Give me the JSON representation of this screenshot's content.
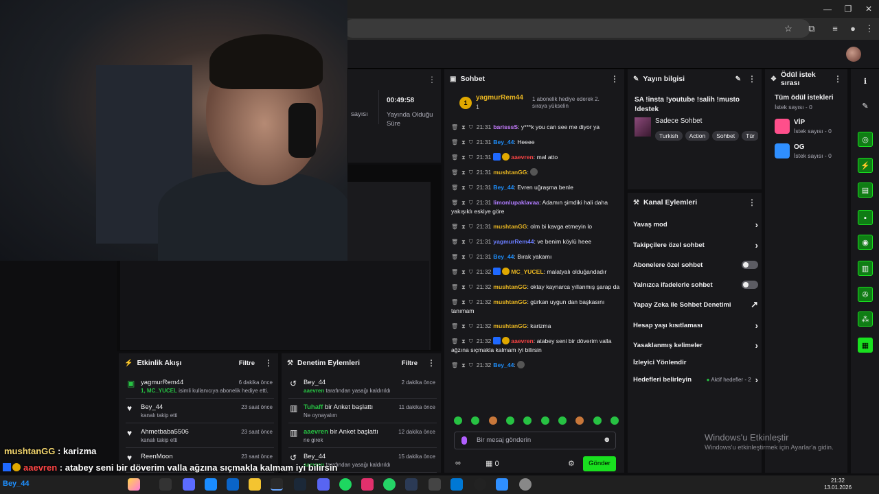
{
  "stats": {
    "duration": "00:49:58",
    "duration_label": "Yayında Olduğu Süre",
    "partial_label": "sayısı"
  },
  "chat": {
    "title": "Sohbet",
    "pinned": {
      "rank": "1",
      "user": "yagmurRem44",
      "count": "1",
      "message": "1 abonelik hediye ederek 2. sıraya yükselin"
    },
    "messages": [
      {
        "time": "21:31",
        "user": "barisssS",
        "color": "#c77dff",
        "text": "y***k you can see me diyor ya"
      },
      {
        "time": "21:31",
        "user": "Bey_44",
        "color": "#1e90ff",
        "text": "Heeee"
      },
      {
        "time": "21:31",
        "user": "aaevren",
        "color": "#ff4545",
        "text": "mal atto",
        "badges": true
      },
      {
        "time": "21:31",
        "user": "mushtanGG",
        "color": "#e6b422",
        "text": ""
      },
      {
        "time": "21:31",
        "user": "Bey_44",
        "color": "#1e90ff",
        "text": "Evren uğraşma benle"
      },
      {
        "time": "21:31",
        "user": "limonlupaklavaa",
        "color": "#b07cff",
        "text": "Adamın şimdiki hali daha yakışıklı eskiye göre"
      },
      {
        "time": "21:31",
        "user": "mushtanGG",
        "color": "#e6b422",
        "text": "olm bi kavga etmeyin lo"
      },
      {
        "time": "21:31",
        "user": "yagmurRem44",
        "color": "#6a7dff",
        "text": "ve benim köylü heee"
      },
      {
        "time": "21:31",
        "user": "Bey_44",
        "color": "#1e90ff",
        "text": "Bırak yakamı"
      },
      {
        "time": "21:32",
        "user": "MC_YUCEL",
        "color": "#e6b422",
        "text": "malatyalı olduğandadır",
        "badges": true
      },
      {
        "time": "21:32",
        "user": "mushtanGG",
        "color": "#e6b422",
        "text": "oktay kaynarca yıllanmış şarap da"
      },
      {
        "time": "21:32",
        "user": "mushtanGG",
        "color": "#e6b422",
        "text": "gürkan uygun dan başkasını tanımam"
      },
      {
        "time": "21:32",
        "user": "mushtanGG",
        "color": "#e6b422",
        "text": "karizma"
      },
      {
        "time": "21:32",
        "user": "aaevren",
        "color": "#ff4545",
        "text": "atabey seni bir döverim valla ağzına sıçmakla kalmam iyi bilirsin",
        "badges": true
      },
      {
        "time": "21:32",
        "user": "Bey_44",
        "color": "#1e90ff",
        "text": ""
      }
    ],
    "input_placeholder": "Bir mesaj gönderin",
    "points": "0",
    "send": "Gönder"
  },
  "info": {
    "title_head": "Yayın bilgisi",
    "stream_title": "SA !insta !youtube !salih !musto !destek",
    "category": "Sadece Sohbet",
    "tags": [
      "Turkish",
      "Action",
      "Sohbet",
      "Tür"
    ]
  },
  "actions": {
    "title": "Kanal Eylemleri",
    "items": [
      {
        "label": "Yavaş mod",
        "kind": "chevron"
      },
      {
        "label": "Takipçilere özel sohbet",
        "kind": "chevron"
      },
      {
        "label": "Abonelere özel sohbet",
        "kind": "toggle"
      },
      {
        "label": "Yalnızca ifadelerle sohbet",
        "kind": "toggle"
      },
      {
        "label": "Yapay Zeka ile Sohbet Denetimi",
        "kind": "chart"
      },
      {
        "label": "Hesap yaşı kısıtlaması",
        "kind": "chevron"
      },
      {
        "label": "Yasaklanmış kelimeler",
        "kind": "chevron"
      },
      {
        "label": "İzleyici Yönlendir",
        "kind": "none"
      },
      {
        "label": "Hedefleri belirleyin",
        "kind": "chevron",
        "state": "Aktif hedefler - 2"
      }
    ]
  },
  "rewards": {
    "title": "Ödül istek sırası",
    "all": "Tüm ödül istekleri",
    "all_count": "İstek sayısı - 0",
    "items": [
      {
        "name": "VİP",
        "count": "İstek sayısı - 0",
        "color": "#ff4f8b"
      },
      {
        "name": "OG",
        "count": "İstek sayısı - 0",
        "color": "#2f8fff"
      }
    ]
  },
  "feed": {
    "title": "Etkinlik Akışı",
    "filter": "Filtre",
    "items": [
      {
        "icon": "gift-icon",
        "name": "yagmurRem44",
        "desc_hl": "1, MC_YUCEL",
        "desc": " isimli kullanıcıya abonelik hediye etti.",
        "time": "6 dakika önce"
      },
      {
        "icon": "heart-icon",
        "name": "Bey_44",
        "desc_hl": "",
        "desc": "kanalı takip etti",
        "time": "23 saat önce"
      },
      {
        "icon": "heart-icon",
        "name": "Ahmetbaba5506",
        "desc_hl": "",
        "desc": "kanalı takip etti",
        "time": "23 saat önce"
      },
      {
        "icon": "heart-icon",
        "name": "ReenMoon",
        "desc_hl": "",
        "desc": "",
        "time": "23 saat önce"
      }
    ]
  },
  "mod": {
    "title": "Denetim Eylemleri",
    "filter": "Filtre",
    "items": [
      {
        "icon": "undo-icon",
        "name": "Bey_44",
        "name_hl": "",
        "desc_hl": "aaevren",
        "desc": " tarafından yasağı kaldırıldı",
        "time": "2 dakika önce"
      },
      {
        "icon": "poll-icon",
        "name": " bir Anket başlattı",
        "name_hl": "Tuhaff",
        "desc_hl": "",
        "desc": "Ne oynayalım",
        "time": "11 dakika önce"
      },
      {
        "icon": "poll-icon",
        "name": " bir Anket başlattı",
        "name_hl": "aaevren",
        "desc_hl": "",
        "desc": "ne girek",
        "time": "12 dakika önce"
      },
      {
        "icon": "undo-icon",
        "name": "Bey_44",
        "name_hl": "",
        "desc_hl": "aaevren",
        "desc": " tarafından yasağı kaldırıldı",
        "time": "15 dakika önce"
      }
    ]
  },
  "overlay": {
    "line1_user": "mushtanGG",
    "line1_msg": " : karizma",
    "line2_user": "aaevren",
    "line2_msg": " : atabey seni bir döverim valla ağzına sıçmakla kalmam iyi bilirsin",
    "taskbar_user": "Bey_44"
  },
  "watermark": {
    "title": "Windows'u Etkinleştir",
    "sub": "Windows'u etkinleştirmek için Ayarlar'a gidin."
  },
  "clock": {
    "time": "21:32",
    "date": "13.01.2026"
  }
}
